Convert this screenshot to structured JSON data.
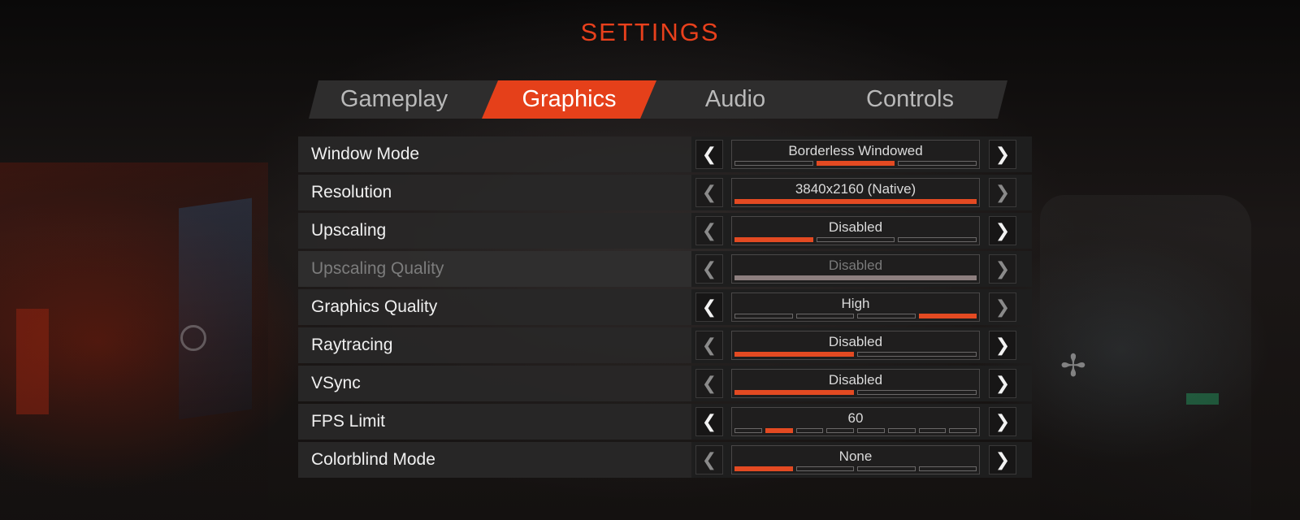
{
  "title": "SETTINGS",
  "tabs": [
    {
      "label": "Gameplay",
      "active": false
    },
    {
      "label": "Graphics",
      "active": true
    },
    {
      "label": "Audio",
      "active": false
    },
    {
      "label": "Controls",
      "active": false
    }
  ],
  "colors": {
    "accent": "#e5401a",
    "title": "#e8401c",
    "row_bg": "#282727",
    "segment_off_border": "#6a6868"
  },
  "icons": {
    "left": "chevron-left-icon",
    "right": "chevron-right-icon"
  },
  "arrow_glyphs": {
    "left": "❮",
    "right": "❯"
  },
  "settings": [
    {
      "label": "Window Mode",
      "value": "Borderless Windowed",
      "segments": 3,
      "selected": 2,
      "fill_mode": "single",
      "left_enabled": true,
      "right_enabled": true,
      "disabled": false
    },
    {
      "label": "Resolution",
      "value": "3840x2160 (Native)",
      "segments": 1,
      "selected": 1,
      "fill_mode": "single",
      "left_enabled": false,
      "right_enabled": false,
      "disabled": false
    },
    {
      "label": "Upscaling",
      "value": "Disabled",
      "segments": 3,
      "selected": 1,
      "fill_mode": "single",
      "left_enabled": false,
      "right_enabled": true,
      "disabled": false
    },
    {
      "label": "Upscaling Quality",
      "value": "Disabled",
      "segments": 1,
      "selected": 0,
      "fill_mode": "single",
      "left_enabled": false,
      "right_enabled": false,
      "disabled": true
    },
    {
      "label": "Graphics Quality",
      "value": "High",
      "segments": 4,
      "selected": 4,
      "fill_mode": "single",
      "left_enabled": true,
      "right_enabled": false,
      "disabled": false
    },
    {
      "label": "Raytracing",
      "value": "Disabled",
      "segments": 2,
      "selected": 1,
      "fill_mode": "single",
      "left_enabled": false,
      "right_enabled": true,
      "disabled": false
    },
    {
      "label": "VSync",
      "value": "Disabled",
      "segments": 2,
      "selected": 1,
      "fill_mode": "single",
      "left_enabled": false,
      "right_enabled": true,
      "disabled": false
    },
    {
      "label": "FPS Limit",
      "value": "60",
      "segments": 8,
      "selected": 2,
      "fill_mode": "single",
      "left_enabled": true,
      "right_enabled": true,
      "disabled": false
    },
    {
      "label": "Colorblind Mode",
      "value": "None",
      "segments": 4,
      "selected": 1,
      "fill_mode": "single",
      "left_enabled": false,
      "right_enabled": true,
      "disabled": false
    }
  ]
}
